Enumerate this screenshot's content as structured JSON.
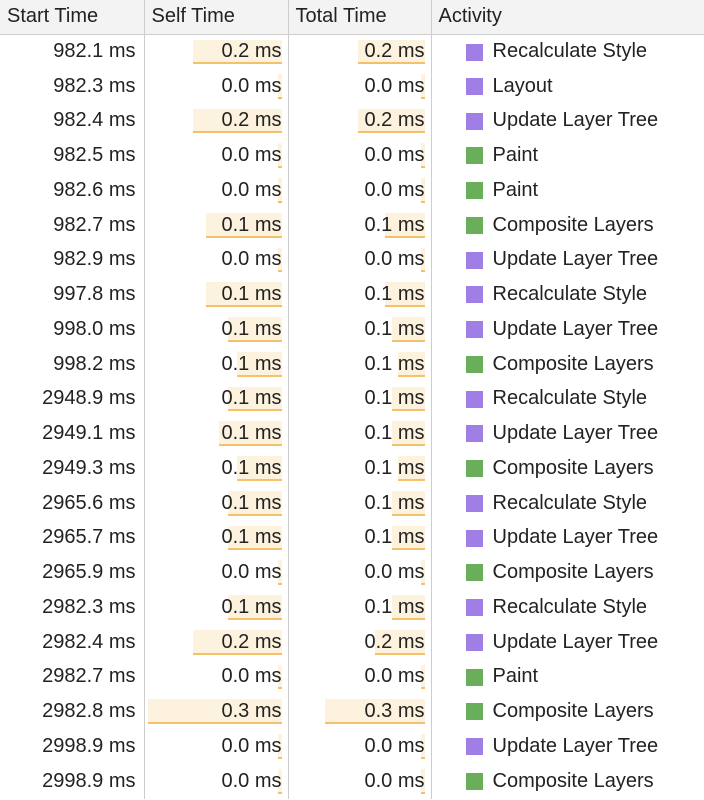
{
  "columns": {
    "start_time": "Start Time",
    "self_time": "Self Time",
    "total_time": "Total Time",
    "activity": "Activity"
  },
  "colors": {
    "style_layout": "#9f7ee5",
    "paint_composite": "#69ae5a",
    "bar_fill": "#fdf2dd",
    "bar_edge": "#f5c06a"
  },
  "max_time_ms": 0.3,
  "rows": [
    {
      "start": "982.1 ms",
      "self": "0.2 ms",
      "total": "0.2 ms",
      "activity": "Recalculate Style",
      "kind": "style",
      "self_ms": 0.2,
      "total_ms": 0.2
    },
    {
      "start": "982.3 ms",
      "self": "0.0 ms",
      "total": "0.0 ms",
      "activity": "Layout",
      "kind": "style",
      "self_ms": 0.01,
      "total_ms": 0.01
    },
    {
      "start": "982.4 ms",
      "self": "0.2 ms",
      "total": "0.2 ms",
      "activity": "Update Layer Tree",
      "kind": "style",
      "self_ms": 0.2,
      "total_ms": 0.2
    },
    {
      "start": "982.5 ms",
      "self": "0.0 ms",
      "total": "0.0 ms",
      "activity": "Paint",
      "kind": "composite",
      "self_ms": 0.01,
      "total_ms": 0.01
    },
    {
      "start": "982.6 ms",
      "self": "0.0 ms",
      "total": "0.0 ms",
      "activity": "Paint",
      "kind": "composite",
      "self_ms": 0.01,
      "total_ms": 0.01
    },
    {
      "start": "982.7 ms",
      "self": "0.1 ms",
      "total": "0.1 ms",
      "activity": "Composite Layers",
      "kind": "composite",
      "self_ms": 0.17,
      "total_ms": 0.12
    },
    {
      "start": "982.9 ms",
      "self": "0.0 ms",
      "total": "0.0 ms",
      "activity": "Update Layer Tree",
      "kind": "style",
      "self_ms": 0.01,
      "total_ms": 0.01
    },
    {
      "start": "997.8 ms",
      "self": "0.1 ms",
      "total": "0.1 ms",
      "activity": "Recalculate Style",
      "kind": "style",
      "self_ms": 0.17,
      "total_ms": 0.12
    },
    {
      "start": "998.0 ms",
      "self": "0.1 ms",
      "total": "0.1 ms",
      "activity": "Update Layer Tree",
      "kind": "style",
      "self_ms": 0.12,
      "total_ms": 0.1
    },
    {
      "start": "998.2 ms",
      "self": "0.1 ms",
      "total": "0.1 ms",
      "activity": "Composite Layers",
      "kind": "composite",
      "self_ms": 0.1,
      "total_ms": 0.08
    },
    {
      "start": "2948.9 ms",
      "self": "0.1 ms",
      "total": "0.1 ms",
      "activity": "Recalculate Style",
      "kind": "style",
      "self_ms": 0.12,
      "total_ms": 0.1
    },
    {
      "start": "2949.1 ms",
      "self": "0.1 ms",
      "total": "0.1 ms",
      "activity": "Update Layer Tree",
      "kind": "style",
      "self_ms": 0.14,
      "total_ms": 0.1
    },
    {
      "start": "2949.3 ms",
      "self": "0.1 ms",
      "total": "0.1 ms",
      "activity": "Composite Layers",
      "kind": "composite",
      "self_ms": 0.1,
      "total_ms": 0.08
    },
    {
      "start": "2965.6 ms",
      "self": "0.1 ms",
      "total": "0.1 ms",
      "activity": "Recalculate Style",
      "kind": "style",
      "self_ms": 0.12,
      "total_ms": 0.1
    },
    {
      "start": "2965.7 ms",
      "self": "0.1 ms",
      "total": "0.1 ms",
      "activity": "Update Layer Tree",
      "kind": "style",
      "self_ms": 0.12,
      "total_ms": 0.1
    },
    {
      "start": "2965.9 ms",
      "self": "0.0 ms",
      "total": "0.0 ms",
      "activity": "Composite Layers",
      "kind": "composite",
      "self_ms": 0.01,
      "total_ms": 0.01
    },
    {
      "start": "2982.3 ms",
      "self": "0.1 ms",
      "total": "0.1 ms",
      "activity": "Recalculate Style",
      "kind": "style",
      "self_ms": 0.12,
      "total_ms": 0.1
    },
    {
      "start": "2982.4 ms",
      "self": "0.2 ms",
      "total": "0.2 ms",
      "activity": "Update Layer Tree",
      "kind": "style",
      "self_ms": 0.2,
      "total_ms": 0.15
    },
    {
      "start": "2982.7 ms",
      "self": "0.0 ms",
      "total": "0.0 ms",
      "activity": "Paint",
      "kind": "composite",
      "self_ms": 0.01,
      "total_ms": 0.01
    },
    {
      "start": "2982.8 ms",
      "self": "0.3 ms",
      "total": "0.3 ms",
      "activity": "Composite Layers",
      "kind": "composite",
      "self_ms": 0.3,
      "total_ms": 0.3
    },
    {
      "start": "2998.9 ms",
      "self": "0.0 ms",
      "total": "0.0 ms",
      "activity": "Update Layer Tree",
      "kind": "style",
      "self_ms": 0.01,
      "total_ms": 0.01
    },
    {
      "start": "2998.9 ms",
      "self": "0.0 ms",
      "total": "0.0 ms",
      "activity": "Composite Layers",
      "kind": "composite",
      "self_ms": 0.01,
      "total_ms": 0.01
    }
  ]
}
